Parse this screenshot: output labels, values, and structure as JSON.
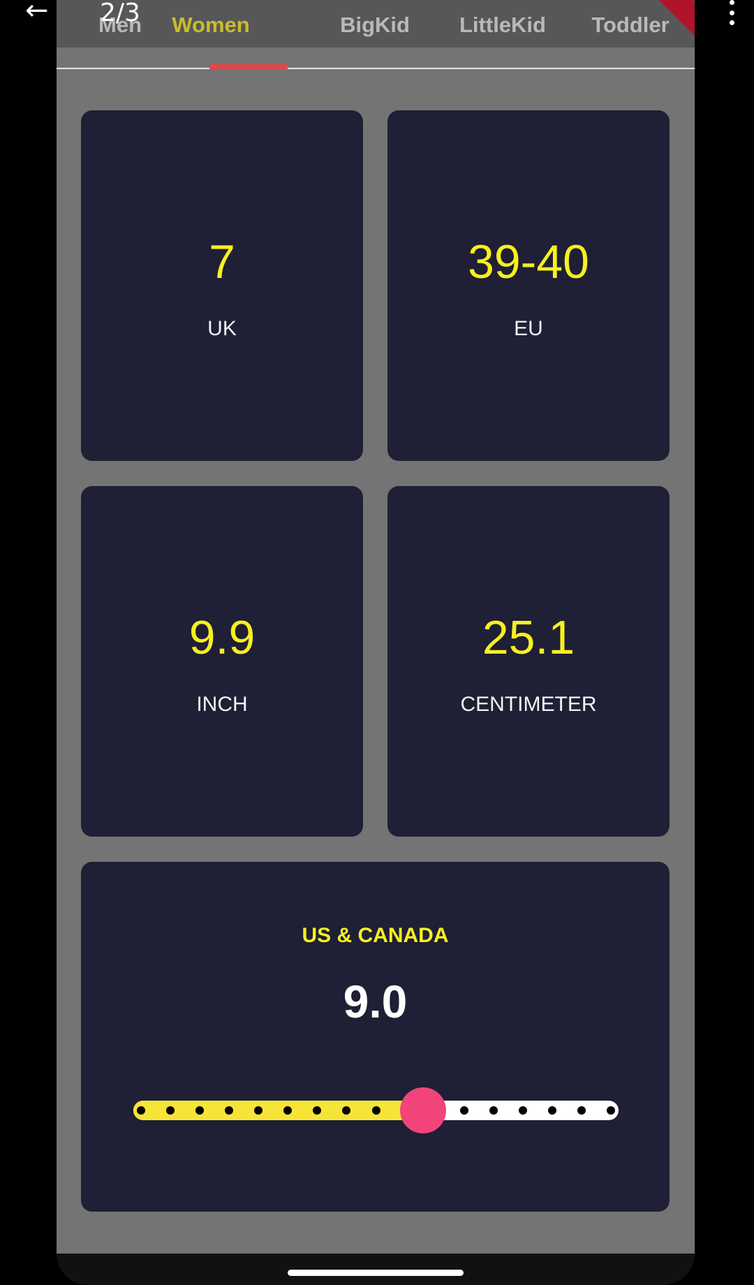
{
  "viewer": {
    "back_icon": "arrow-left-icon",
    "counter": "2/3",
    "menu_icon": "more-vert-icon"
  },
  "tabs": [
    {
      "label": "Men",
      "active": false
    },
    {
      "label": "Women",
      "active": true
    },
    {
      "label": "BigKid",
      "active": false
    },
    {
      "label": "LittleKid",
      "active": false
    },
    {
      "label": "Toddler",
      "active": false
    }
  ],
  "cards": {
    "uk": {
      "value": "7",
      "label": "UK"
    },
    "eu": {
      "value": "39-40",
      "label": "EU"
    },
    "inch": {
      "value": "9.9",
      "label": "INCH"
    },
    "cm": {
      "value": "25.1",
      "label": "CENTIMETER"
    }
  },
  "us": {
    "title": "US & CANADA",
    "value": "9.0",
    "slider_fraction": 0.6,
    "slider_divisions": 16
  },
  "colors": {
    "card_bg": "#1f1f35",
    "value_yellow": "#f6f020",
    "thumb_pink": "#f2447a",
    "active_track": "#f6e536",
    "tab_indicator": "#e04848"
  }
}
